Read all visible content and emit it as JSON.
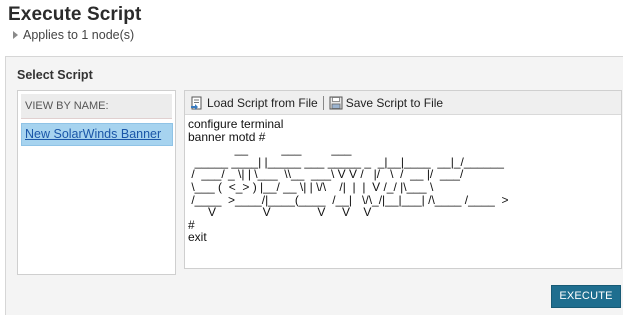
{
  "page": {
    "title": "Execute Script",
    "applies_to": "Applies to 1 node(s)"
  },
  "select_script": {
    "section_title": "Select Script",
    "list_header": "VIEW BY NAME:",
    "items": [
      {
        "label": "New SolarWinds Banner",
        "selected": true
      }
    ]
  },
  "editor": {
    "load_label": "Load Script from File",
    "save_label": "Save Script to File",
    "script": "configure terminal\nbanner motd #\n              __          ___         ___\n  _____ ____| |_____ ___ _____ _  _|__|____  __|_/______\n /  ___/ _ \\| | \\___  \\\\__  ___\\ V V /   |/   \\  /  __ |/  ___/\n \\___ (  <_> ) |__/ __ \\| | \\/\\    /|  |  |  V /_/ |\\___ \\\n /____  >____/|____(____  /__|   \\/\\_/|__|___| /\\____ /____  >\n      V              V              V     V    V\n#\nexit"
  },
  "actions": {
    "execute_label": "EXECUTE"
  },
  "colors": {
    "execute_bg": "#1f6e8f",
    "selected_item_bg": "#a6d3ef",
    "link": "#1a56a8"
  },
  "icons": [
    "expand-arrow-icon",
    "load-file-icon",
    "save-file-icon"
  ]
}
